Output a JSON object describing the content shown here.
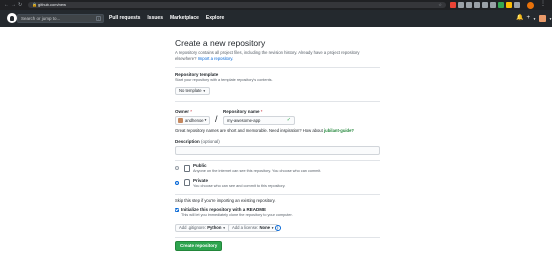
{
  "browser": {
    "url": "github.com/new",
    "extension_colors": [
      "#ea4335",
      "#9aa0a6",
      "#9aa0a6",
      "#9aa0a6",
      "#9aa0a6",
      "#9aa0a6",
      "#34a853",
      "#fbbc04",
      "#9aa0a6"
    ]
  },
  "header": {
    "search_placeholder": "Search or jump to...",
    "search_shortcut": "/",
    "nav": [
      "Pull requests",
      "Issues",
      "Marketplace",
      "Explore"
    ]
  },
  "page": {
    "title": "Create a new repository",
    "intro": "A repository contains all project files, including the revision history. Already have a project repository elsewhere?",
    "import_link": "Import a repository."
  },
  "template": {
    "label": "Repository template",
    "description": "Start your repository with a template repository's contents.",
    "button": "No template"
  },
  "owner": {
    "label": "Owner",
    "required": "*",
    "value": "andhenoe"
  },
  "repo_name": {
    "label": "Repository name",
    "required": "*",
    "value": "my-awesome-app"
  },
  "name_hint": {
    "text": "Great repository names are short and memorable. Need inspiration? How about",
    "suggestion": "jubilant-guide?"
  },
  "description": {
    "label": "Description",
    "optional": "(optional)",
    "value": ""
  },
  "visibility": {
    "selected": "private",
    "options": [
      {
        "title": "Public",
        "desc": "Anyone on the internet can see this repository. You choose who can commit."
      },
      {
        "title": "Private",
        "desc": "You choose who can see and commit to this repository."
      }
    ]
  },
  "init": {
    "skip_text": "Skip this step if you're importing an existing repository.",
    "readme_label": "Initialize this repository with a README",
    "readme_desc": "This will let you immediately clone the repository to your computer.",
    "readme_checked": true,
    "gitignore_prefix": "Add .gitignore:",
    "gitignore_value": "Python",
    "license_prefix": "Add a license:",
    "license_value": "None"
  },
  "submit": {
    "label": "Create repository",
    "color": "#2ea44f"
  }
}
